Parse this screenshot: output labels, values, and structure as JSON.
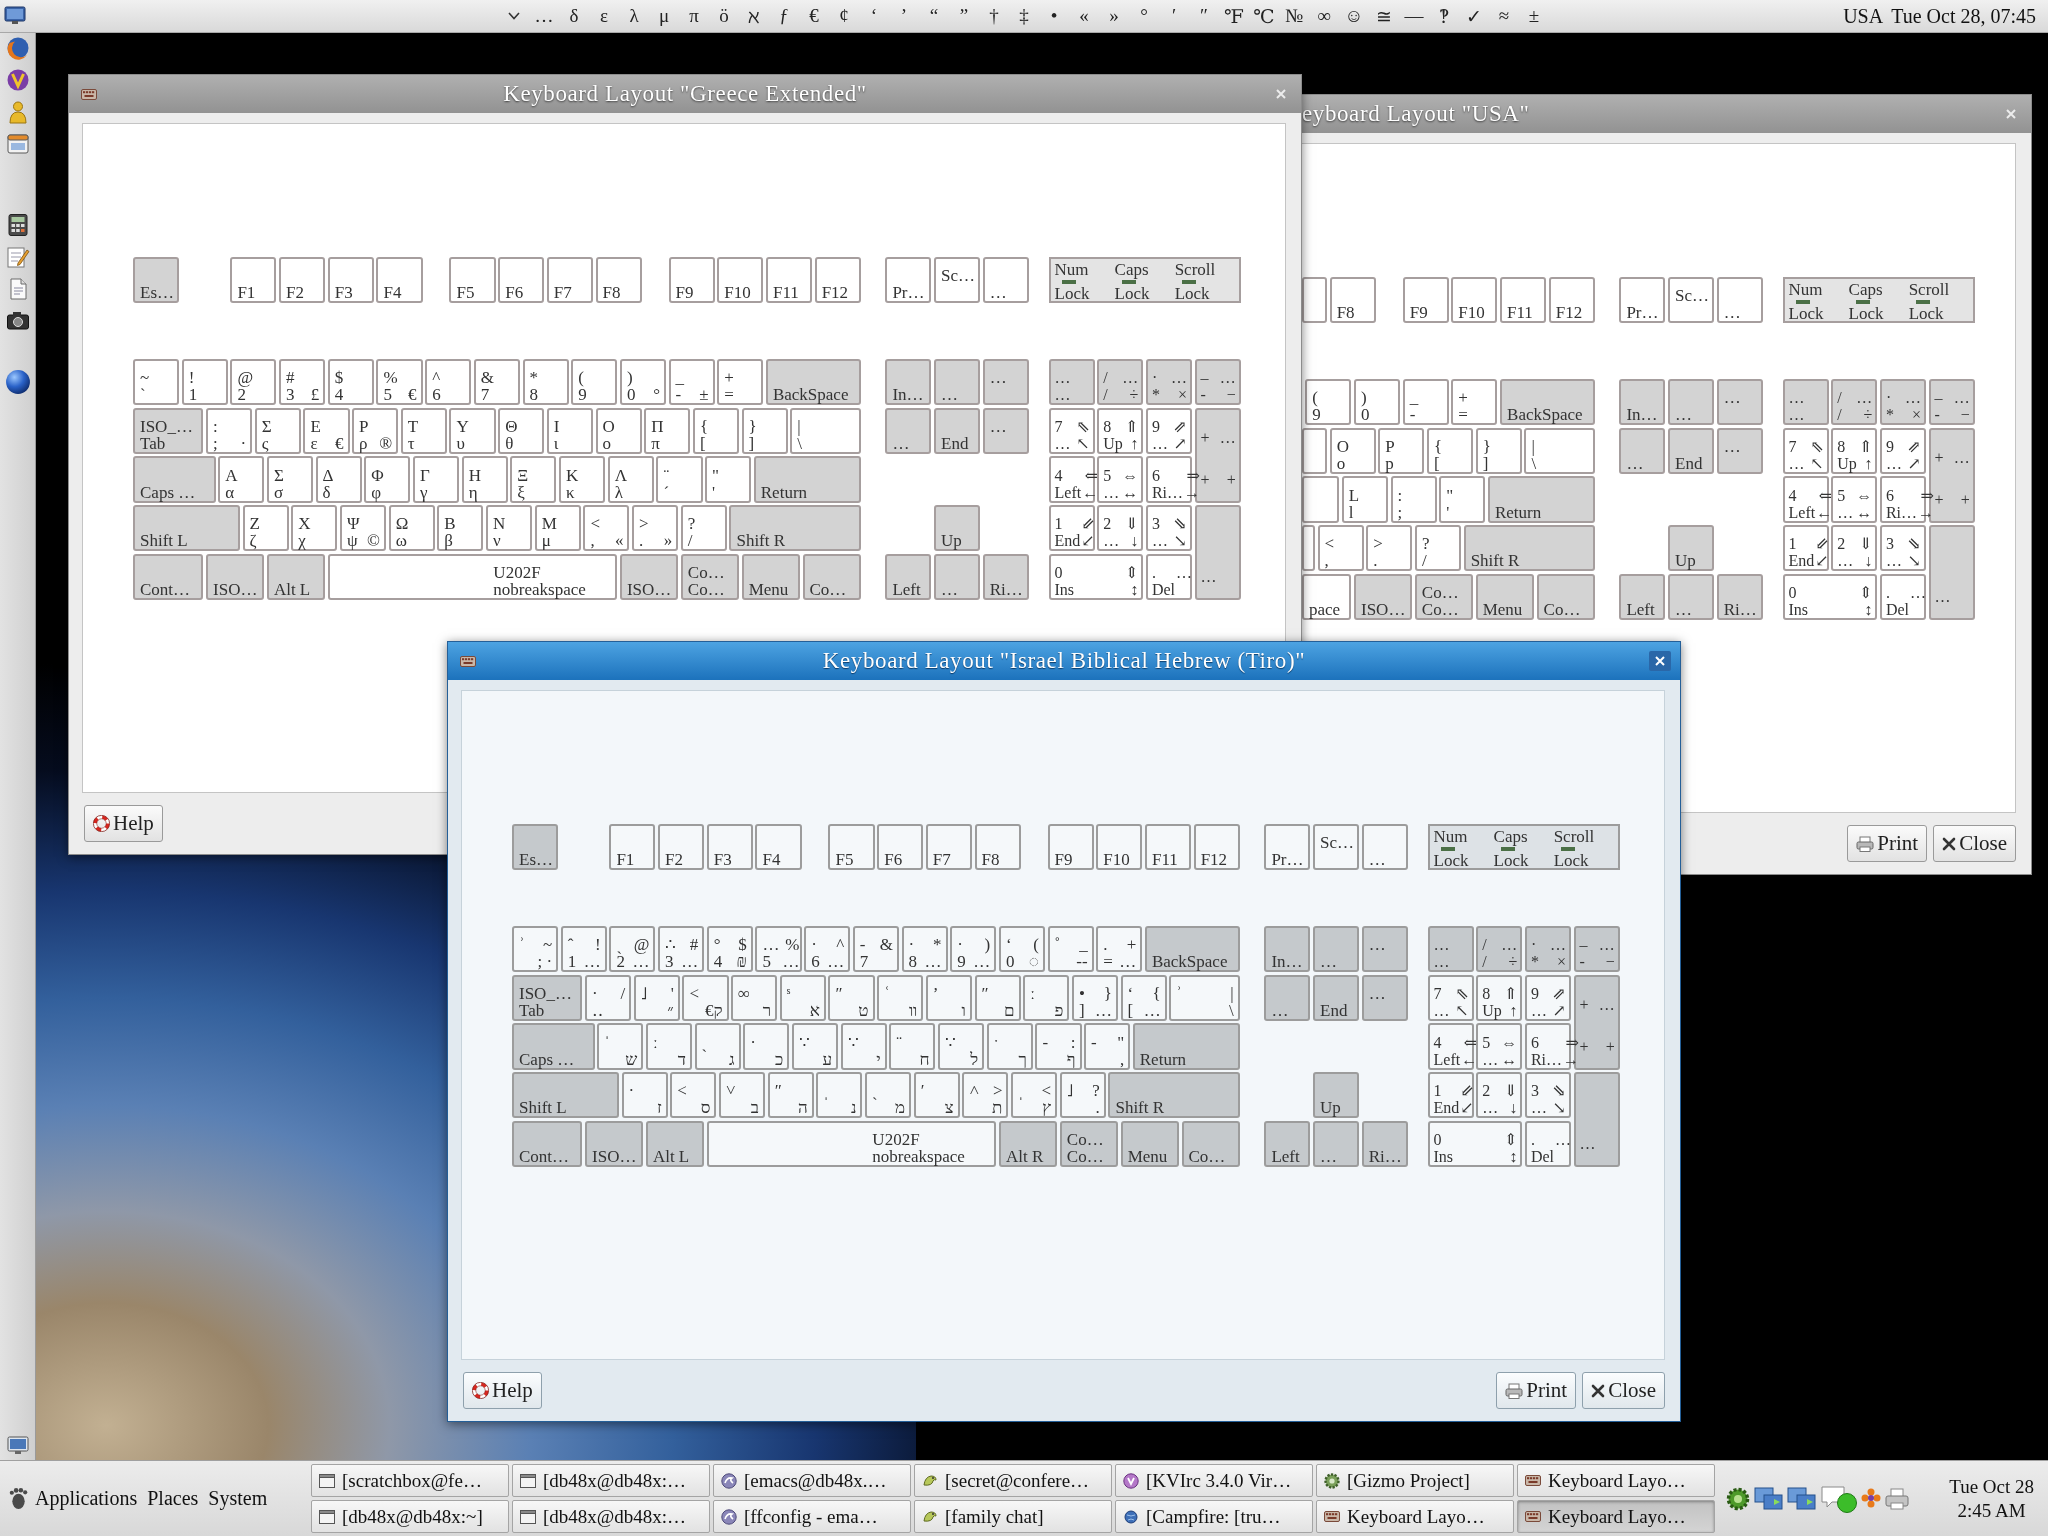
{
  "top_panel": {
    "characters": [
      "…",
      "δ",
      "ε",
      "λ",
      "μ",
      "π",
      "ö",
      "ℵ",
      "ƒ",
      "€",
      "¢",
      "‘",
      "’",
      "“",
      "”",
      "†",
      "‡",
      "•",
      "«",
      "»",
      "°",
      "′",
      "″",
      "℉",
      "℃",
      "№",
      "∞",
      "☺",
      "≅",
      "—",
      "‽",
      "✓",
      "≈",
      "±"
    ],
    "layout_indicator": "USA",
    "clock": "Tue Oct 28, 07:45"
  },
  "windows": [
    {
      "title": "Keyboard Layout \"Greece Extended\"",
      "active": false,
      "keyboard": {
        "key_rows": [
          {
            "lead": {
              "kind": "modifier",
              "base": "Es…"
            },
            "keys": [
              {
                "kind": "plain",
                "base": "F1"
              },
              {
                "kind": "plain",
                "base": "F2"
              },
              {
                "kind": "plain",
                "base": "F3"
              },
              {
                "kind": "plain",
                "base": "F4"
              },
              {
                "kind": "plain",
                "base": "F5"
              },
              {
                "kind": "plain",
                "base": "F6"
              },
              {
                "kind": "plain",
                "base": "F7"
              },
              {
                "kind": "plain",
                "base": "F8"
              },
              {
                "kind": "plain",
                "base": "F9"
              },
              {
                "kind": "plain",
                "base": "F10"
              },
              {
                "kind": "plain",
                "base": "F11"
              },
              {
                "kind": "plain",
                "base": "F12"
              }
            ]
          },
          {
            "keys": [
              {
                "kind": "plain",
                "shift": "~",
                "base": "`"
              },
              {
                "kind": "plain",
                "shift": "!",
                "base": "1"
              },
              {
                "kind": "plain",
                "shift": "@",
                "base": "2"
              },
              {
                "kind": "plain",
                "shift": "#",
                "base": "3",
                "alt": "£"
              },
              {
                "kind": "plain",
                "shift": "$",
                "base": "4"
              },
              {
                "kind": "plain",
                "shift": "%",
                "base": "5",
                "alt": "€"
              },
              {
                "kind": "plain",
                "shift": "^",
                "base": "6"
              },
              {
                "kind": "plain",
                "shift": "&",
                "base": "7"
              },
              {
                "kind": "plain",
                "shift": "*",
                "base": "8"
              },
              {
                "kind": "plain",
                "shift": "(",
                "base": "9"
              },
              {
                "kind": "plain",
                "shift": ")",
                "base": "0",
                "alt": "°"
              },
              {
                "kind": "plain",
                "shift": "_",
                "base": "-",
                "alt": "±"
              },
              {
                "kind": "plain",
                "shift": "+",
                "base": "="
              }
            ],
            "tail": {
              "kind": "modifier",
              "base": "BackSpace"
            }
          },
          {
            "lead": {
              "kind": "modifier",
              "shift": "ISO_…",
              "base": "Tab"
            },
            "keys": [
              {
                "kind": "plain",
                "shift": ":",
                "base": ";",
                "alt": "·"
              },
              {
                "kind": "plain",
                "shift": "Σ",
                "base": "ς"
              },
              {
                "kind": "plain",
                "shift": "Ε",
                "base": "ε",
                "alt": "€"
              },
              {
                "kind": "plain",
                "shift": "Ρ",
                "base": "ρ",
                "alt": "®"
              },
              {
                "kind": "plain",
                "shift": "Τ",
                "base": "τ"
              },
              {
                "kind": "plain",
                "shift": "Υ",
                "base": "υ"
              },
              {
                "kind": "plain",
                "shift": "Θ",
                "base": "θ"
              },
              {
                "kind": "plain",
                "shift": "Ι",
                "base": "ι"
              },
              {
                "kind": "plain",
                "shift": "Ο",
                "base": "ο"
              },
              {
                "kind": "plain",
                "shift": "Π",
                "base": "π"
              },
              {
                "kind": "plain",
                "shift": "{",
                "base": "["
              },
              {
                "kind": "plain",
                "shift": "}",
                "base": "]"
              },
              {
                "kind": "plain",
                "shift": "|",
                "base": "\\"
              }
            ]
          },
          {
            "lead": {
              "kind": "modifier",
              "base": "Caps …"
            },
            "keys": [
              {
                "kind": "plain",
                "shift": "Α",
                "base": "α"
              },
              {
                "kind": "plain",
                "shift": "Σ",
                "base": "σ"
              },
              {
                "kind": "plain",
                "shift": "Δ",
                "base": "δ"
              },
              {
                "kind": "plain",
                "shift": "Φ",
                "base": "φ"
              },
              {
                "kind": "plain",
                "shift": "Γ",
                "base": "γ"
              },
              {
                "kind": "plain",
                "shift": "Η",
                "base": "η"
              },
              {
                "kind": "plain",
                "shift": "Ξ",
                "base": "ξ"
              },
              {
                "kind": "plain",
                "shift": "Κ",
                "base": "κ"
              },
              {
                "kind": "plain",
                "shift": "Λ",
                "base": "λ"
              },
              {
                "kind": "plain",
                "shift": "¨",
                "base": "´"
              },
              {
                "kind": "plain",
                "shift": "\"",
                "base": "'"
              }
            ],
            "tail": {
              "kind": "modifier",
              "base": "Return"
            }
          },
          {
            "lead": {
              "kind": "modifier",
              "base": "Shift L"
            },
            "keys": [
              {
                "kind": "plain",
                "shift": "Ζ",
                "base": "ζ"
              },
              {
                "kind": "plain",
                "shift": "Χ",
                "base": "χ"
              },
              {
                "kind": "plain",
                "shift": "Ψ",
                "base": "ψ",
                "alt": "©"
              },
              {
                "kind": "plain",
                "shift": "Ω",
                "base": "ω"
              },
              {
                "kind": "plain",
                "shift": "Β",
                "base": "β"
              },
              {
                "kind": "plain",
                "shift": "Ν",
                "base": "ν"
              },
              {
                "kind": "plain",
                "shift": "Μ",
                "base": "μ"
              },
              {
                "kind": "plain",
                "shift": "<",
                "base": ",",
                "alt": "«"
              },
              {
                "kind": "plain",
                "shift": ">",
                "base": ".",
                "alt": "»"
              },
              {
                "kind": "plain",
                "shift": "?",
                "base": "/"
              }
            ],
            "tail": {
              "kind": "modifier",
              "base": "Shift R"
            }
          },
          {
            "keys": [
              {
                "kind": "modifier",
                "base": "Cont…"
              },
              {
                "kind": "modifier",
                "base": "ISO…"
              },
              {
                "kind": "modifier",
                "base": "Alt L"
              },
              {
                "kind": "plain",
                "shift": "U202F",
                "base": "nobreakspace"
              },
              {
                "kind": "modifier",
                "base": "ISO…"
              },
              {
                "kind": "modifier",
                "shift": "Co…",
                "base": "Co…"
              },
              {
                "kind": "modifier",
                "base": "Menu"
              },
              {
                "kind": "modifier",
                "base": "Co…"
              }
            ]
          }
        ],
        "system_keys": [
          {
            "kind": "plain",
            "base": "Pr…"
          },
          {
            "kind": "plain",
            "shift": "Sc…"
          },
          {
            "kind": "plain",
            "base": "…"
          }
        ],
        "locks": [
          {
            "lines": [
              "Num",
              "Lock"
            ],
            "on": false
          },
          {
            "lines": [
              "Caps",
              "Lock"
            ],
            "on": false
          },
          {
            "lines": [
              "Scroll",
              "Lock"
            ],
            "on": false
          }
        ],
        "navigation_keys": [
          {
            "kind": "modifier",
            "base": "In…"
          },
          {
            "kind": "modifier",
            "base": "…"
          },
          {
            "kind": "modifier",
            "shift": "…"
          },
          {
            "kind": "modifier",
            "base": "…"
          },
          {
            "kind": "modifier",
            "base": "End"
          },
          {
            "kind": "modifier",
            "shift": "…"
          },
          {
            "kind": "modifier",
            "base": "Up"
          },
          {
            "kind": "modifier",
            "base": "Left"
          },
          {
            "kind": "modifier",
            "base": "…"
          },
          {
            "kind": "modifier",
            "base": "Ri…"
          }
        ],
        "numpad": [
          {
            "kind": "modifier",
            "shift": "…",
            "base": "…"
          },
          {
            "kind": "modifier",
            "shift": "/",
            "alt_shift": "…",
            "base": "/",
            "alt": "÷"
          },
          {
            "kind": "modifier",
            "shift": "·",
            "alt_shift": "…",
            "base": "*",
            "alt": "×"
          },
          {
            "kind": "modifier",
            "shift": "–",
            "alt_shift": "…",
            "base": "-",
            "alt": "−"
          },
          {
            "kind": "plain",
            "shift": "7",
            "alt_shift": "⇖",
            "base": "…",
            "alt": "↖"
          },
          {
            "kind": "plain",
            "shift": "8",
            "alt_shift": "⇑",
            "base": "Up",
            "alt": "↑"
          },
          {
            "kind": "plain",
            "shift": "9",
            "alt_shift": "⇗",
            "base": "…",
            "alt": "↗"
          },
          {
            "kind": "modifier",
            "shift": "+",
            "alt_shift": "…",
            "base": "+",
            "alt": "+"
          },
          {
            "kind": "plain",
            "shift": "4",
            "alt_shift": "⇐",
            "base": "Left",
            "alt": "←"
          },
          {
            "kind": "plain",
            "shift": "5",
            "alt_shift": "⇔",
            "base": "…",
            "alt": "↔"
          },
          {
            "kind": "plain",
            "shift": "6",
            "alt_shift": "⇒",
            "base": "Ri…",
            "alt": "→"
          },
          {
            "kind": "plain",
            "shift": "1",
            "alt_shift": "⇙",
            "base": "End",
            "alt": "↙"
          },
          {
            "kind": "plain",
            "shift": "2",
            "alt_shift": "⇓",
            "base": "…",
            "alt": "↓"
          },
          {
            "kind": "plain",
            "shift": "3",
            "alt_shift": "⇘",
            "base": "…",
            "alt": "↘"
          },
          {
            "kind": "plain",
            "shift": "0",
            "alt_shift": "⇕",
            "base": "Ins",
            "alt": "↕"
          },
          {
            "kind": "plain",
            "shift": ".",
            "alt_shift": "…",
            "base": "Del"
          },
          {
            "kind": "modifier",
            "base": "…"
          }
        ]
      },
      "buttons": [
        {
          "kind": "help",
          "label": "Help"
        }
      ]
    },
    {
      "title": "eyboard Layout \"USA\"",
      "active": false,
      "keyboard": {
        "key_rows": [
          {
            "keys": [
              {
                "kind": "plain"
              },
              {
                "kind": "plain",
                "base": "F8"
              },
              {
                "kind": "plain",
                "base": "F9"
              },
              {
                "kind": "plain",
                "base": "F10"
              },
              {
                "kind": "plain",
                "base": "F11"
              },
              {
                "kind": "plain",
                "base": "F12"
              }
            ]
          },
          {
            "keys": [
              {
                "kind": "plain",
                "shift": "(",
                "base": "9"
              },
              {
                "kind": "plain",
                "shift": ")",
                "base": "0"
              },
              {
                "kind": "plain",
                "shift": "_",
                "base": "-"
              },
              {
                "kind": "plain",
                "shift": "+",
                "base": "="
              }
            ],
            "tail": {
              "kind": "modifier",
              "base": "BackSpace"
            }
          },
          {
            "keys": [
              {
                "kind": "plain"
              },
              {
                "kind": "plain",
                "shift": "O",
                "base": "o"
              },
              {
                "kind": "plain",
                "shift": "P",
                "base": "p"
              },
              {
                "kind": "plain",
                "shift": "{",
                "base": "["
              },
              {
                "kind": "plain",
                "shift": "}",
                "base": "]"
              },
              {
                "kind": "plain",
                "shift": "|",
                "base": "\\"
              }
            ]
          },
          {
            "keys": [
              {
                "kind": "plain"
              },
              {
                "kind": "plain",
                "shift": "L",
                "base": "l"
              },
              {
                "kind": "plain",
                "shift": ":",
                "base": ";"
              },
              {
                "kind": "plain",
                "shift": "\"",
                "base": "'"
              }
            ],
            "tail": {
              "kind": "modifier",
              "base": "Return"
            }
          },
          {
            "keys": [
              {
                "kind": "plain"
              },
              {
                "kind": "plain",
                "shift": "<",
                "base": ","
              },
              {
                "kind": "plain",
                "shift": ">",
                "base": "."
              },
              {
                "kind": "plain",
                "shift": "?",
                "base": "/"
              }
            ],
            "tail": {
              "kind": "modifier",
              "base": "Shift R"
            }
          },
          {
            "keys": [
              {
                "kind": "plain",
                "base": "pace"
              },
              {
                "kind": "modifier",
                "base": "ISO…"
              },
              {
                "kind": "modifier",
                "shift": "Co…",
                "base": "Co…"
              },
              {
                "kind": "modifier",
                "base": "Menu"
              },
              {
                "kind": "modifier",
                "base": "Co…"
              }
            ]
          }
        ],
        "system_keys": [
          {
            "kind": "plain",
            "base": "Pr…"
          },
          {
            "kind": "plain",
            "shift": "Sc…"
          },
          {
            "kind": "plain",
            "base": "…"
          }
        ],
        "locks": [
          {
            "lines": [
              "Num",
              "Lock"
            ],
            "on": false
          },
          {
            "lines": [
              "Caps",
              "Lock"
            ],
            "on": false
          },
          {
            "lines": [
              "Scroll",
              "Lock"
            ],
            "on": false
          }
        ],
        "navigation_keys": [
          {
            "kind": "modifier",
            "base": "In…"
          },
          {
            "kind": "modifier",
            "base": "…"
          },
          {
            "kind": "modifier",
            "shift": "…"
          },
          {
            "kind": "modifier",
            "base": "…"
          },
          {
            "kind": "modifier",
            "base": "End"
          },
          {
            "kind": "modifier",
            "shift": "…"
          },
          {
            "kind": "modifier",
            "base": "Up"
          },
          {
            "kind": "modifier",
            "base": "Left"
          },
          {
            "kind": "modifier",
            "base": "…"
          },
          {
            "kind": "modifier",
            "base": "Ri…"
          }
        ],
        "numpad": [
          {
            "kind": "modifier",
            "shift": "…",
            "base": "…"
          },
          {
            "kind": "modifier",
            "shift": "/",
            "alt_shift": "…",
            "base": "/",
            "alt": "÷"
          },
          {
            "kind": "modifier",
            "shift": "·",
            "alt_shift": "…",
            "base": "*",
            "alt": "×"
          },
          {
            "kind": "modifier",
            "shift": "–",
            "alt_shift": "…",
            "base": "-",
            "alt": "−"
          },
          {
            "kind": "plain",
            "shift": "7",
            "alt_shift": "⇖",
            "base": "…",
            "alt": "↖"
          },
          {
            "kind": "plain",
            "shift": "8",
            "alt_shift": "⇑",
            "base": "Up",
            "alt": "↑"
          },
          {
            "kind": "plain",
            "shift": "9",
            "alt_shift": "⇗",
            "base": "…",
            "alt": "↗"
          },
          {
            "kind": "modifier",
            "shift": "+",
            "alt_shift": "…",
            "base": "+",
            "alt": "+"
          },
          {
            "kind": "plain",
            "shift": "4",
            "alt_shift": "⇐",
            "base": "Left",
            "alt": "←"
          },
          {
            "kind": "plain",
            "shift": "5",
            "alt_shift": "⇔",
            "base": "…",
            "alt": "↔"
          },
          {
            "kind": "plain",
            "shift": "6",
            "alt_shift": "⇒",
            "base": "Ri…",
            "alt": "→"
          },
          {
            "kind": "plain",
            "shift": "1",
            "alt_shift": "⇙",
            "base": "End",
            "alt": "↙"
          },
          {
            "kind": "plain",
            "shift": "2",
            "alt_shift": "⇓",
            "base": "…",
            "alt": "↓"
          },
          {
            "kind": "plain",
            "shift": "3",
            "alt_shift": "⇘",
            "base": "…",
            "alt": "↘"
          },
          {
            "kind": "plain",
            "shift": "0",
            "alt_shift": "⇕",
            "base": "Ins",
            "alt": "↕"
          },
          {
            "kind": "plain",
            "shift": ".",
            "alt_shift": "…",
            "base": "Del"
          },
          {
            "kind": "modifier",
            "base": "…"
          }
        ]
      },
      "buttons": [
        {
          "kind": "print",
          "label": "Print"
        },
        {
          "kind": "close",
          "label": "Close"
        }
      ]
    },
    {
      "title": "Keyboard Layout \"Israel Biblical Hebrew (Tiro)\"",
      "active": true,
      "keyboard": {
        "key_rows": [
          {
            "lead": {
              "kind": "modifier",
              "base": "Es…"
            },
            "keys": [
              {
                "kind": "plain",
                "base": "F1"
              },
              {
                "kind": "plain",
                "base": "F2"
              },
              {
                "kind": "plain",
                "base": "F3"
              },
              {
                "kind": "plain",
                "base": "F4"
              },
              {
                "kind": "plain",
                "base": "F5"
              },
              {
                "kind": "plain",
                "base": "F6"
              },
              {
                "kind": "plain",
                "base": "F7"
              },
              {
                "kind": "plain",
                "base": "F8"
              },
              {
                "kind": "plain",
                "base": "F9"
              },
              {
                "kind": "plain",
                "base": "F10"
              },
              {
                "kind": "plain",
                "base": "F11"
              },
              {
                "kind": "plain",
                "base": "F12"
              }
            ]
          },
          {
            "keys": [
              {
                "kind": "plain",
                "shift": "ʾ",
                "alt_shift": "~",
                "alt": "; ·"
              },
              {
                "kind": "plain",
                "shift": "ˆ",
                "alt_shift": "!",
                "base": "1",
                "alt": "…"
              },
              {
                "kind": "plain",
                "shift": "ˎ",
                "alt_shift": "@",
                "base": "2",
                "alt": "…"
              },
              {
                "kind": "plain",
                "shift": "∴",
                "alt_shift": "#",
                "base": "3",
                "alt": "…"
              },
              {
                "kind": "plain",
                "shift": "°",
                "alt_shift": "$",
                "base": "4",
                "alt": "₪"
              },
              {
                "kind": "plain",
                "shift": "…",
                "alt_shift": "%",
                "base": "5",
                "alt": "…"
              },
              {
                "kind": "plain",
                "shift": "·",
                "alt_shift": "^",
                "base": "6",
                "alt": "…"
              },
              {
                "kind": "plain",
                "shift": "-",
                "alt_shift": "&",
                "base": "7"
              },
              {
                "kind": "plain",
                "shift": "·",
                "alt_shift": "*",
                "base": "8",
                "alt": "…"
              },
              {
                "kind": "plain",
                "shift": "·",
                "alt_shift": ")",
                "base": "9",
                "alt": "…"
              },
              {
                "kind": "plain",
                "shift": "ʻ",
                "alt_shift": "(",
                "base": "0",
                "alt": "◌"
              },
              {
                "kind": "plain",
                "shift": "˚",
                "alt_shift": "_",
                "alt": "--"
              },
              {
                "kind": "plain",
                "shift": ".",
                "alt_shift": "+",
                "base": "=",
                "alt": "…"
              }
            ],
            "tail": {
              "kind": "modifier",
              "base": "BackSpace"
            }
          },
          {
            "lead": {
              "kind": "modifier",
              "shift": "ISO_…",
              "base": "Tab"
            },
            "keys": [
              {
                "kind": "plain",
                "shift": "·",
                "alt_shift": "/",
                "base": "‥"
              },
              {
                "kind": "letter",
                "shift": "˩",
                "alt_shift": "'"
              },
              {
                "kind": "letter",
                "shift": "˂"
              },
              {
                "kind": "letter",
                "shift": "∞"
              },
              {
                "kind": "letter",
                "shift": "ˢ"
              },
              {
                "kind": "letter",
                "shift": "ʺ"
              },
              {
                "kind": "letter",
                "shift": "ʿ"
              },
              {
                "kind": "letter",
                "shift": "ʼ"
              },
              {
                "kind": "letter",
                "shift": "ʺ"
              },
              {
                "kind": "letter",
                "shift": "ː"
              },
              {
                "kind": "plain",
                "shift": "•",
                "alt_shift": "}",
                "base": "]",
                "alt": "…"
              },
              {
                "kind": "plain",
                "shift": "ʻ",
                "alt_shift": "{",
                "base": "[",
                "alt": "…"
              },
              {
                "kind": "plain",
                "shift": "ʾ",
                "alt_shift": "|",
                "alt": "\\"
              }
            ],
            "letter_labels": [
              "פ",
              "ם",
              "ו",
              "װ",
              "ט",
              "א",
              "ר",
              "€ק",
              "״"
            ]
          },
          {
            "lead": {
              "kind": "modifier",
              "base": "Caps …"
            },
            "keys": [
              {
                "kind": "letter",
                "shift": "ˈ"
              },
              {
                "kind": "letter",
                "shift": "ː"
              },
              {
                "kind": "letter",
                "shift": "ˎ"
              },
              {
                "kind": "letter",
                "shift": "·"
              },
              {
                "kind": "letter",
                "shift": "∵"
              },
              {
                "kind": "letter",
                "shift": "∵"
              },
              {
                "kind": "letter",
                "shift": "¨"
              },
              {
                "kind": "letter",
                "shift": "∵"
              },
              {
                "kind": "letter",
                "shift": "ˑ"
              },
              {
                "kind": "letter",
                "shift": "-",
                "alt_shift": ":"
              },
              {
                "kind": "plain",
                "shift": "-",
                "alt_shift": "\"",
                "alt": ","
              }
            ],
            "letter_labels": [
              "ף",
              "ך",
              "ל",
              "ח",
              "י",
              "ע",
              "כ",
              "ג",
              "ד",
              "ש"
            ],
            "tail": {
              "kind": "modifier",
              "base": "Return"
            }
          },
          {
            "lead": {
              "kind": "modifier",
              "base": "Shift L"
            },
            "keys": [
              {
                "kind": "letter",
                "shift": "·"
              },
              {
                "kind": "letter",
                "shift": "˂"
              },
              {
                "kind": "letter",
                "shift": "˅"
              },
              {
                "kind": "letter",
                "shift": "ʺ"
              },
              {
                "kind": "letter",
                "shift": "ˌ"
              },
              {
                "kind": "letter",
                "shift": "ˏ"
              },
              {
                "kind": "letter",
                "shift": "ʹ"
              },
              {
                "kind": "letter",
                "shift": "˄",
                "alt_shift": ">"
              },
              {
                "kind": "letter",
                "shift": "ˌ",
                "alt_shift": "<"
              },
              {
                "kind": "plain",
                "shift": "˩",
                "alt_shift": "?",
                "alt": "."
              }
            ],
            "letter_labels": [
              "ץ",
              "ת",
              "צ",
              "מ",
              "נ",
              "ה",
              "ב",
              "ס",
              "ז"
            ],
            "tail": {
              "kind": "modifier",
              "base": "Shift R"
            }
          },
          {
            "keys": [
              {
                "kind": "modifier",
                "base": "Cont…"
              },
              {
                "kind": "modifier",
                "base": "ISO…"
              },
              {
                "kind": "modifier",
                "base": "Alt L"
              },
              {
                "kind": "plain",
                "shift": "U202F",
                "base": "nobreakspace"
              },
              {
                "kind": "modifier",
                "base": "Alt R"
              },
              {
                "kind": "modifier",
                "shift": "Co…",
                "base": "Co…"
              },
              {
                "kind": "modifier",
                "base": "Menu"
              },
              {
                "kind": "modifier",
                "base": "Co…"
              }
            ]
          }
        ],
        "system_keys": [
          {
            "kind": "plain",
            "base": "Pr…"
          },
          {
            "kind": "plain",
            "shift": "Sc…"
          },
          {
            "kind": "plain",
            "base": "…"
          }
        ],
        "locks": [
          {
            "lines": [
              "Num",
              "Lock"
            ],
            "on": false
          },
          {
            "lines": [
              "Caps",
              "Lock"
            ],
            "on": false
          },
          {
            "lines": [
              "Scroll",
              "Lock"
            ],
            "on": false
          }
        ],
        "navigation_keys": [
          {
            "kind": "modifier",
            "base": "In…"
          },
          {
            "kind": "modifier",
            "base": "…"
          },
          {
            "kind": "modifier",
            "shift": "…"
          },
          {
            "kind": "modifier",
            "base": "…"
          },
          {
            "kind": "modifier",
            "base": "End"
          },
          {
            "kind": "modifier",
            "shift": "…"
          },
          {
            "kind": "modifier",
            "base": "Up"
          },
          {
            "kind": "modifier",
            "base": "Left"
          },
          {
            "kind": "modifier",
            "base": "…"
          },
          {
            "kind": "modifier",
            "base": "Ri…"
          }
        ],
        "numpad": [
          {
            "kind": "modifier",
            "shift": "…",
            "base": "…"
          },
          {
            "kind": "modifier",
            "shift": "/",
            "alt_shift": "…",
            "base": "/",
            "alt": "÷"
          },
          {
            "kind": "modifier",
            "shift": "·",
            "alt_shift": "…",
            "base": "*",
            "alt": "×"
          },
          {
            "kind": "modifier",
            "shift": "–",
            "alt_shift": "…",
            "base": "-",
            "alt": "−"
          },
          {
            "kind": "plain",
            "shift": "7",
            "alt_shift": "⇖",
            "base": "…",
            "alt": "↖"
          },
          {
            "kind": "plain",
            "shift": "8",
            "alt_shift": "⇑",
            "base": "Up",
            "alt": "↑"
          },
          {
            "kind": "plain",
            "shift": "9",
            "alt_shift": "⇗",
            "base": "…",
            "alt": "↗"
          },
          {
            "kind": "modifier",
            "shift": "+",
            "alt_shift": "…",
            "base": "+",
            "alt": "+"
          },
          {
            "kind": "plain",
            "shift": "4",
            "alt_shift": "⇐",
            "base": "Left",
            "alt": "←"
          },
          {
            "kind": "plain",
            "shift": "5",
            "alt_shift": "⇔",
            "base": "…",
            "alt": "↔"
          },
          {
            "kind": "plain",
            "shift": "6",
            "alt_shift": "⇒",
            "base": "Ri…",
            "alt": "→"
          },
          {
            "kind": "plain",
            "shift": "1",
            "alt_shift": "⇙",
            "base": "End",
            "alt": "↙"
          },
          {
            "kind": "plain",
            "shift": "2",
            "alt_shift": "⇓",
            "base": "…",
            "alt": "↓"
          },
          {
            "kind": "plain",
            "shift": "3",
            "alt_shift": "⇘",
            "base": "…",
            "alt": "↘"
          },
          {
            "kind": "plain",
            "shift": "0",
            "alt_shift": "⇕",
            "base": "Ins",
            "alt": "↕"
          },
          {
            "kind": "plain",
            "shift": ".",
            "alt_shift": "…",
            "base": "Del"
          },
          {
            "kind": "modifier",
            "base": "…"
          }
        ]
      },
      "buttons": [
        {
          "kind": "help",
          "label": "Help"
        },
        {
          "kind": "print",
          "label": "Print"
        },
        {
          "kind": "close",
          "label": "Close"
        }
      ]
    }
  ],
  "taskbar": {
    "menus": [
      "Applications",
      "Places",
      "System"
    ],
    "tasks": [
      {
        "label": "[scratchbox@fe…",
        "kind": "terminal",
        "selected": false
      },
      {
        "label": "[db48x@db48x:…",
        "kind": "terminal",
        "selected": false
      },
      {
        "label": "[emacs@db48x.…",
        "kind": "editor",
        "selected": false
      },
      {
        "label": "[secret@confere…",
        "kind": "chat",
        "selected": false
      },
      {
        "label": "[KVIrc 3.4.0 Vir…",
        "kind": "irc",
        "selected": false
      },
      {
        "label": "[Gizmo Project]",
        "kind": "phone",
        "selected": false
      },
      {
        "label": "Keyboard Layo…",
        "kind": "keyboard",
        "selected": false
      },
      {
        "label": "[db48x@db48x:~]",
        "kind": "terminal",
        "selected": false
      },
      {
        "label": "[db48x@db48x:…",
        "kind": "terminal",
        "selected": false
      },
      {
        "label": "[ffconfig - ema…",
        "kind": "editor",
        "selected": false
      },
      {
        "label": "[family chat]",
        "kind": "chat",
        "selected": false
      },
      {
        "label": "[Campfire: [tru…",
        "kind": "web",
        "selected": false
      },
      {
        "label": "Keyboard Layo…",
        "kind": "keyboard",
        "selected": false
      },
      {
        "label": "Keyboard Layo…",
        "kind": "keyboard",
        "selected": true
      }
    ],
    "clock": {
      "date": "Tue Oct 28",
      "time": "2:45 AM"
    }
  }
}
